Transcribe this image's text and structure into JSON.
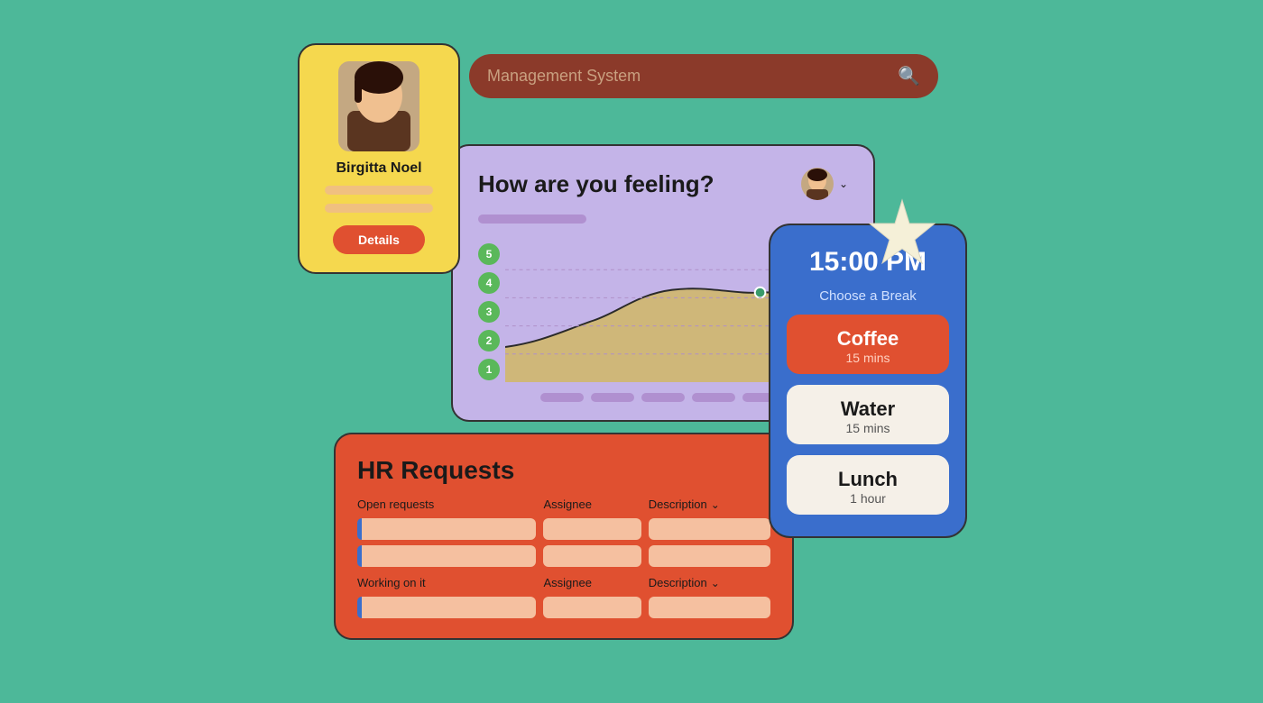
{
  "search": {
    "placeholder": "Management System",
    "value": "Management System"
  },
  "profile": {
    "name": "Birgitta Noel",
    "details_button": "Details"
  },
  "feeling": {
    "title": "How are you feeling?",
    "y_labels": [
      "1",
      "2",
      "3",
      "4",
      "5"
    ],
    "legend_count": 5
  },
  "break": {
    "time": "15:00 PM",
    "subtitle": "Choose a Break",
    "options": [
      {
        "title": "Coffee",
        "duration": "15 mins",
        "selected": true
      },
      {
        "title": "Water",
        "duration": "15 mins",
        "selected": false
      },
      {
        "title": "Lunch",
        "duration": "1 hour",
        "selected": false
      }
    ]
  },
  "hr": {
    "title": "HR Requests",
    "open_label": "Open requests",
    "assignee_label": "Assignee",
    "description_label": "Description",
    "working_label": "Working on it",
    "assignee_label2": "Assignee",
    "description_label2": "Description"
  }
}
